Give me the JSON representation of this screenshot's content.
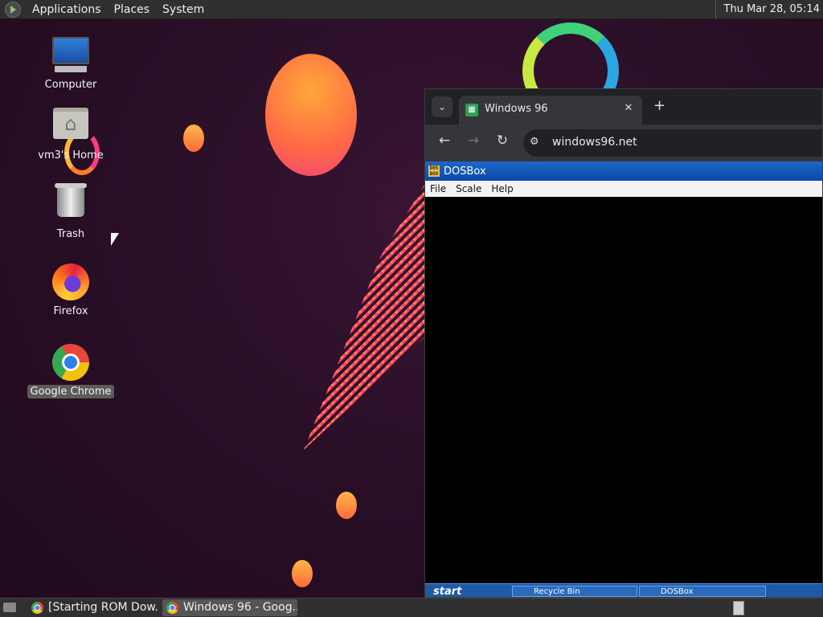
{
  "top_panel": {
    "menus": [
      "Applications",
      "Places",
      "System"
    ],
    "clock": "Thu Mar 28, 05:14"
  },
  "desktop_icons": [
    {
      "label": "Computer",
      "icon": "computer-icon"
    },
    {
      "label": "vm3's Home",
      "icon": "home-folder-icon"
    },
    {
      "label": "Trash",
      "icon": "trash-icon"
    },
    {
      "label": "Firefox",
      "icon": "firefox-icon"
    },
    {
      "label": "Google Chrome",
      "icon": "chrome-icon",
      "selected": true
    }
  ],
  "browser": {
    "tab_title": "Windows 96",
    "tab_close": "✕",
    "new_tab": "+",
    "url": "windows96.net",
    "nav": {
      "back": "←",
      "forward": "→",
      "reload": "↻",
      "tab_search": "⌄",
      "site_info": "⚙"
    }
  },
  "dosbox": {
    "title": "DOSBox",
    "icon_text": "DOS BOX",
    "menu": [
      "File",
      "Scale",
      "Help"
    ],
    "taskbar": {
      "start": "start",
      "tasks": [
        "Recycle Bin",
        "DOSBox"
      ]
    }
  },
  "bottom_panel": {
    "tasks": [
      {
        "label": "[Starting ROM Dow...",
        "active": false
      },
      {
        "label": "Windows 96 - Goog...",
        "active": true
      }
    ]
  }
}
